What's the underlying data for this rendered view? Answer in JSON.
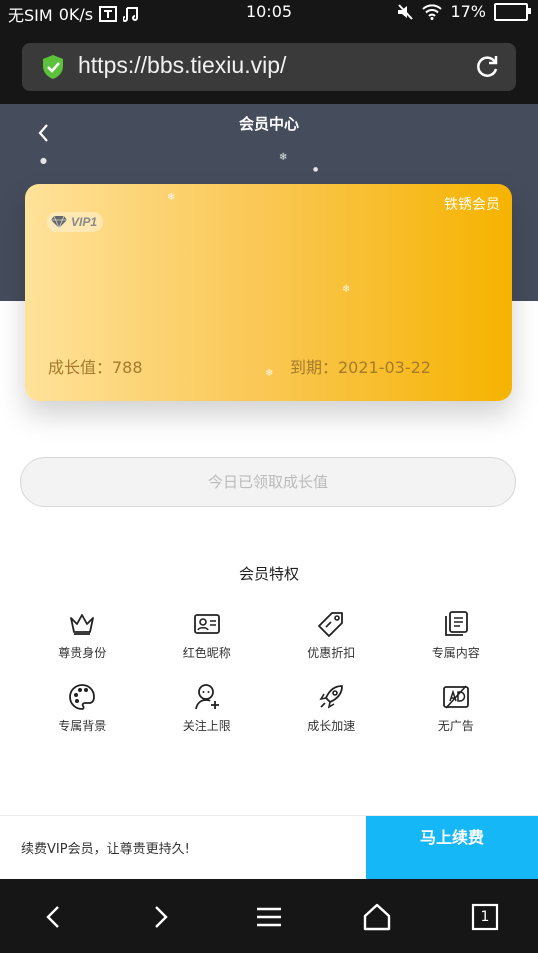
{
  "status_bar": {
    "carrier": "无SIM",
    "speed": "0K/s",
    "time": "10:05",
    "battery": "17%"
  },
  "browser": {
    "url": "https://bbs.tiexiu.vip/"
  },
  "header": {
    "title": "会员中心"
  },
  "card": {
    "vip_level": "VIP1",
    "member_type": "铁锈会员",
    "growth_label": "成长值：788",
    "expiry_label": "到期：2021-03-22",
    "badge": "V"
  },
  "claim_button": {
    "label": "今日已领取成长值"
  },
  "privileges": {
    "title": "会员特权",
    "items": [
      {
        "label": "尊贵身份",
        "icon": "crown-icon"
      },
      {
        "label": "红色昵称",
        "icon": "id-card-icon"
      },
      {
        "label": "优惠折扣",
        "icon": "tag-icon"
      },
      {
        "label": "专属内容",
        "icon": "documents-icon"
      },
      {
        "label": "专属背景",
        "icon": "palette-icon"
      },
      {
        "label": "关注上限",
        "icon": "add-user-icon"
      },
      {
        "label": "成长加速",
        "icon": "rocket-icon"
      },
      {
        "label": "无广告",
        "icon": "no-ads-icon"
      }
    ]
  },
  "renew": {
    "tip": "续费VIP会员，让尊贵更持久!",
    "button": "马上续费"
  },
  "nav": {
    "tabs_count": "1"
  },
  "colors": {
    "header_bg": "#454d5d",
    "renew_button": "#16b7f6",
    "card_gold": "#f6b300"
  }
}
